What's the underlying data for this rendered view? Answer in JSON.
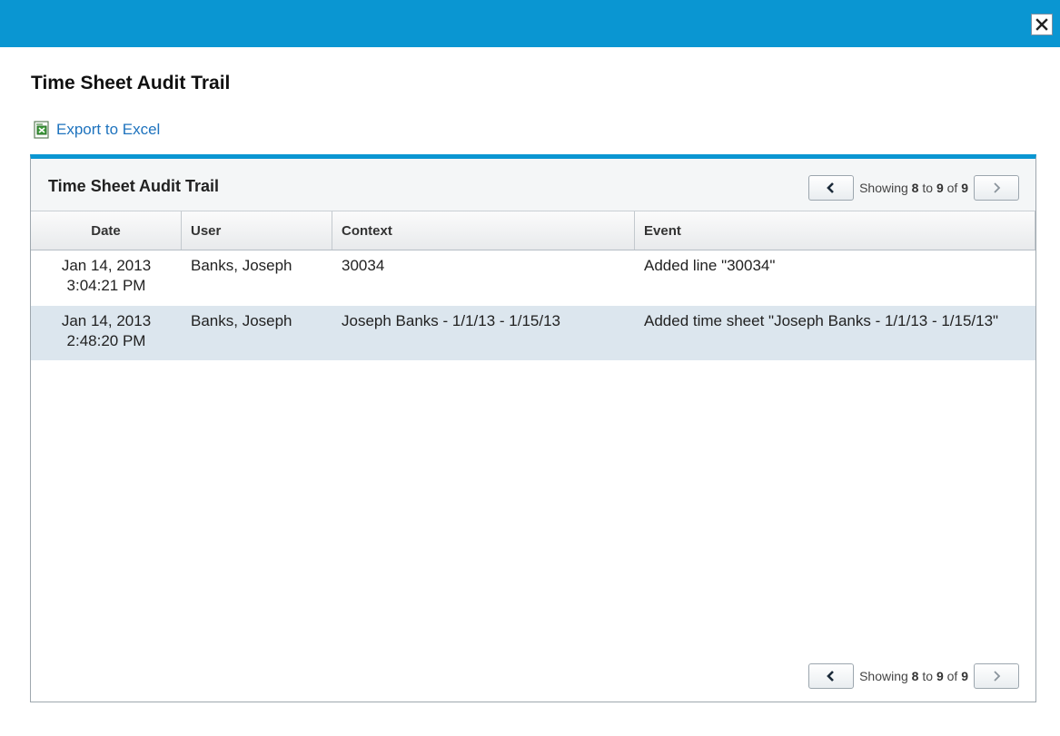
{
  "dialog": {
    "title": "Time Sheet Audit Trail",
    "export_label": "Export to Excel",
    "accent_color": "#0a96d2"
  },
  "panel": {
    "title": "Time Sheet Audit Trail",
    "pager": {
      "prefix": "Showing ",
      "from": "8",
      "to_word": " to ",
      "to": "9",
      "of_word": " of ",
      "total": "9"
    }
  },
  "table": {
    "columns": [
      "Date",
      "User",
      "Context",
      "Event"
    ],
    "rows": [
      {
        "date": "Jan 14, 2013",
        "time": "3:04:21 PM",
        "user": "Banks, Joseph",
        "context": "30034",
        "event": "Added line \"30034\""
      },
      {
        "date": "Jan 14, 2013",
        "time": "2:48:20 PM",
        "user": "Banks, Joseph",
        "context": "Joseph Banks - 1/1/13 - 1/15/13",
        "event": "Added time sheet \"Joseph Banks - 1/1/13 - 1/15/13\""
      }
    ]
  },
  "icons": {
    "close": "close-icon",
    "excel": "excel-icon",
    "prev": "chevron-left-icon",
    "next": "chevron-right-icon"
  }
}
